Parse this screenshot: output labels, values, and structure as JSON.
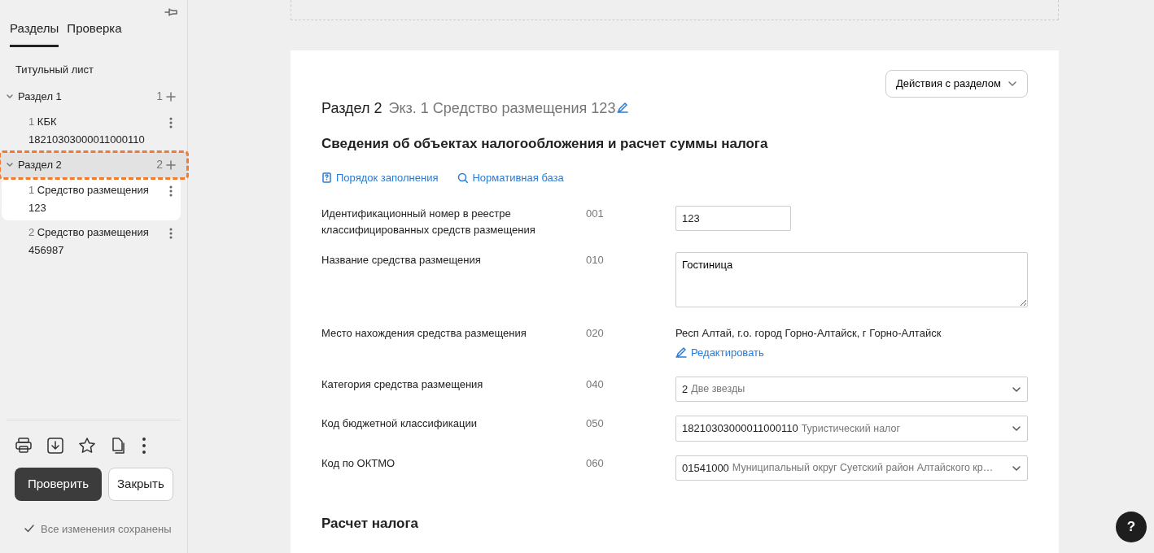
{
  "sidebar": {
    "tabs": [
      {
        "label": "Разделы",
        "selected": true
      },
      {
        "label": "Проверка",
        "selected": false
      }
    ],
    "items": [
      {
        "kind": "page",
        "label": "Титульный лист",
        "selected": false
      },
      {
        "kind": "section",
        "label": "Раздел 1",
        "count": "1",
        "expanded": true,
        "selected": false,
        "children": [
          {
            "number": "1",
            "label": "КБК",
            "sub": "18210303000011000110",
            "selected": false
          }
        ]
      },
      {
        "kind": "section",
        "label": "Раздел 2",
        "count": "2",
        "expanded": true,
        "selected": true,
        "children": [
          {
            "number": "1",
            "label": "Средство размещения",
            "sub": "123",
            "selected": true
          },
          {
            "number": "2",
            "label": "Средство размещения",
            "sub": "456987",
            "selected": false
          }
        ]
      }
    ],
    "buttons": [
      {
        "label": "Проверить",
        "kind": "primary"
      },
      {
        "label": "Закрыть",
        "kind": "secondary"
      }
    ],
    "status": "Все изменения сохранены"
  },
  "main": {
    "actions_button": "Действия с разделом",
    "section": "Раздел 2",
    "subtitle": "Экз. 1 Средство размещения 123",
    "title": "Сведения об объектах налогообложения и расчет суммы налога",
    "links": [
      {
        "kind": "book",
        "label": "Порядок заполнения"
      },
      {
        "kind": "search",
        "label": "Нормативная база"
      }
    ],
    "fields": [
      {
        "kind": "input",
        "label": "Идентификационный номер в реестре классифицированных средств размещения",
        "code": "001",
        "value": "123"
      },
      {
        "kind": "textarea",
        "label": "Название средства размещения",
        "code": "010",
        "value": "Гостиница"
      },
      {
        "kind": "address",
        "label": "Место нахождения средства размещения",
        "code": "020",
        "value": "Респ Алтай, г.о. город Горно-Алтайск, г Горно-Алтайск",
        "action": "Редактировать"
      },
      {
        "kind": "select",
        "label": "Категория средства размещения",
        "code": "040",
        "value": "2",
        "description": "Две звезды"
      },
      {
        "kind": "select",
        "label": "Код бюджетной классификации",
        "code": "050",
        "value": "18210303000011000110",
        "description": "Туристический налог"
      },
      {
        "kind": "select",
        "label": "Код по ОКТМО",
        "code": "060",
        "value": "01541000",
        "description": "Муниципальный округ Суетский район Алтайского кр…"
      }
    ],
    "subsection": "Расчет налога",
    "help": "?"
  }
}
